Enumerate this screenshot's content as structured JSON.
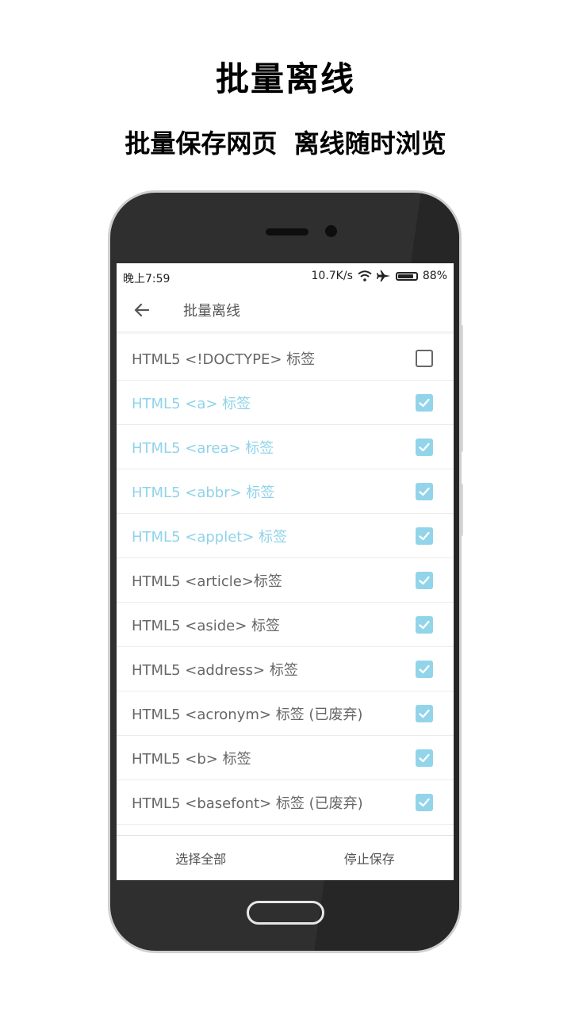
{
  "promo": {
    "title": "批量离线",
    "subtitle": "批量保存网页  离线随时浏览"
  },
  "status_bar": {
    "time": "晚上7:59",
    "speed": "10.7K/s",
    "battery": "88%",
    "icons": [
      "wifi-icon",
      "airplane-icon",
      "battery-icon"
    ]
  },
  "app_bar": {
    "title": "批量离线",
    "back_icon": "arrow-left-icon"
  },
  "list": {
    "items": [
      {
        "label": "HTML5 <!DOCTYPE> 标签",
        "checked": false,
        "highlight": false
      },
      {
        "label": "HTML5 <a> 标签",
        "checked": true,
        "highlight": true
      },
      {
        "label": "HTML5 <area> 标签",
        "checked": true,
        "highlight": true
      },
      {
        "label": "HTML5 <abbr> 标签",
        "checked": true,
        "highlight": true
      },
      {
        "label": "HTML5 <applet> 标签",
        "checked": true,
        "highlight": true
      },
      {
        "label": "HTML5 <article>标签",
        "checked": true,
        "highlight": false
      },
      {
        "label": "HTML5 <aside> 标签",
        "checked": true,
        "highlight": false
      },
      {
        "label": "HTML5 <address> 标签",
        "checked": true,
        "highlight": false
      },
      {
        "label": "HTML5 <acronym> 标签 (已废弃)",
        "checked": true,
        "highlight": false
      },
      {
        "label": "HTML5 <b> 标签",
        "checked": true,
        "highlight": false
      },
      {
        "label": "HTML5 <basefont> 标签 (已废弃)",
        "checked": true,
        "highlight": false
      },
      {
        "label": "",
        "checked": true,
        "highlight": false
      }
    ]
  },
  "bottom_bar": {
    "select_all": "选择全部",
    "stop_save": "停止保存"
  },
  "colors": {
    "accent": "#92d4ea",
    "highlight_text": "#8fd3ea",
    "phone_body": "#2f2f2f"
  }
}
